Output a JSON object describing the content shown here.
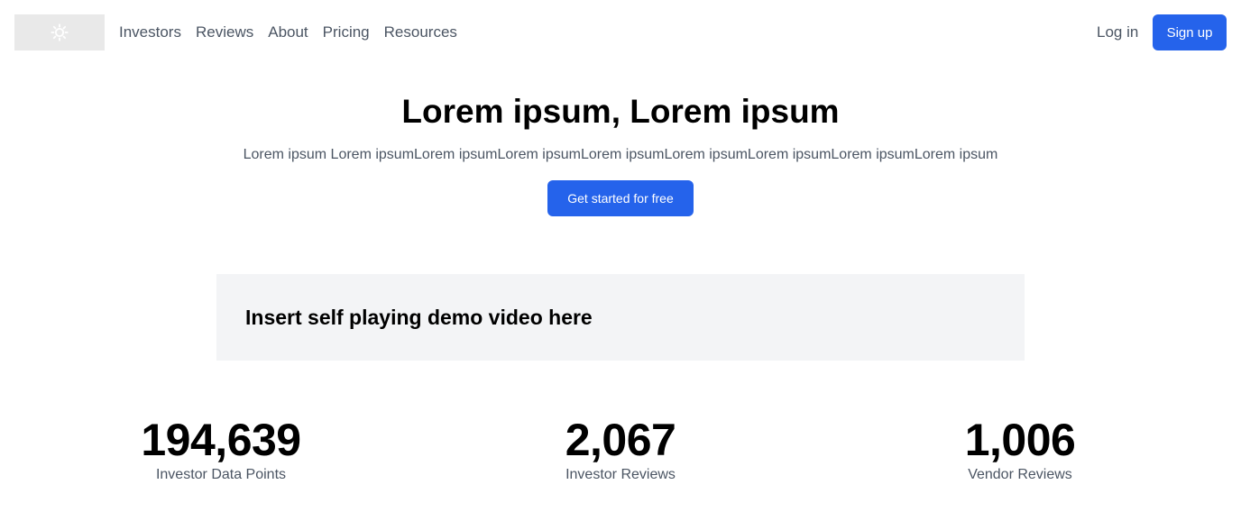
{
  "nav": {
    "logo_icon": "logo-gear-icon",
    "links": [
      "Investors",
      "Reviews",
      "About",
      "Pricing",
      "Resources"
    ],
    "login_label": "Log in",
    "signup_label": "Sign up"
  },
  "hero": {
    "title": "Lorem ipsum, Lorem ipsum",
    "subtitle": "Lorem ipsum Lorem ipsumLorem ipsumLorem ipsumLorem ipsumLorem ipsumLorem ipsumLorem ipsumLorem ipsum",
    "cta_label": "Get started for free"
  },
  "video": {
    "placeholder_text": "Insert self playing demo video here"
  },
  "stats": [
    {
      "value": "194,639",
      "label": "Investor Data Points"
    },
    {
      "value": "2,067",
      "label": "Investor Reviews"
    },
    {
      "value": "1,006",
      "label": "Vendor Reviews"
    }
  ],
  "colors": {
    "primary": "#2563eb",
    "muted_text": "#4b5563",
    "video_bg": "#f3f4f6",
    "logo_bg": "#e9e9e9"
  }
}
